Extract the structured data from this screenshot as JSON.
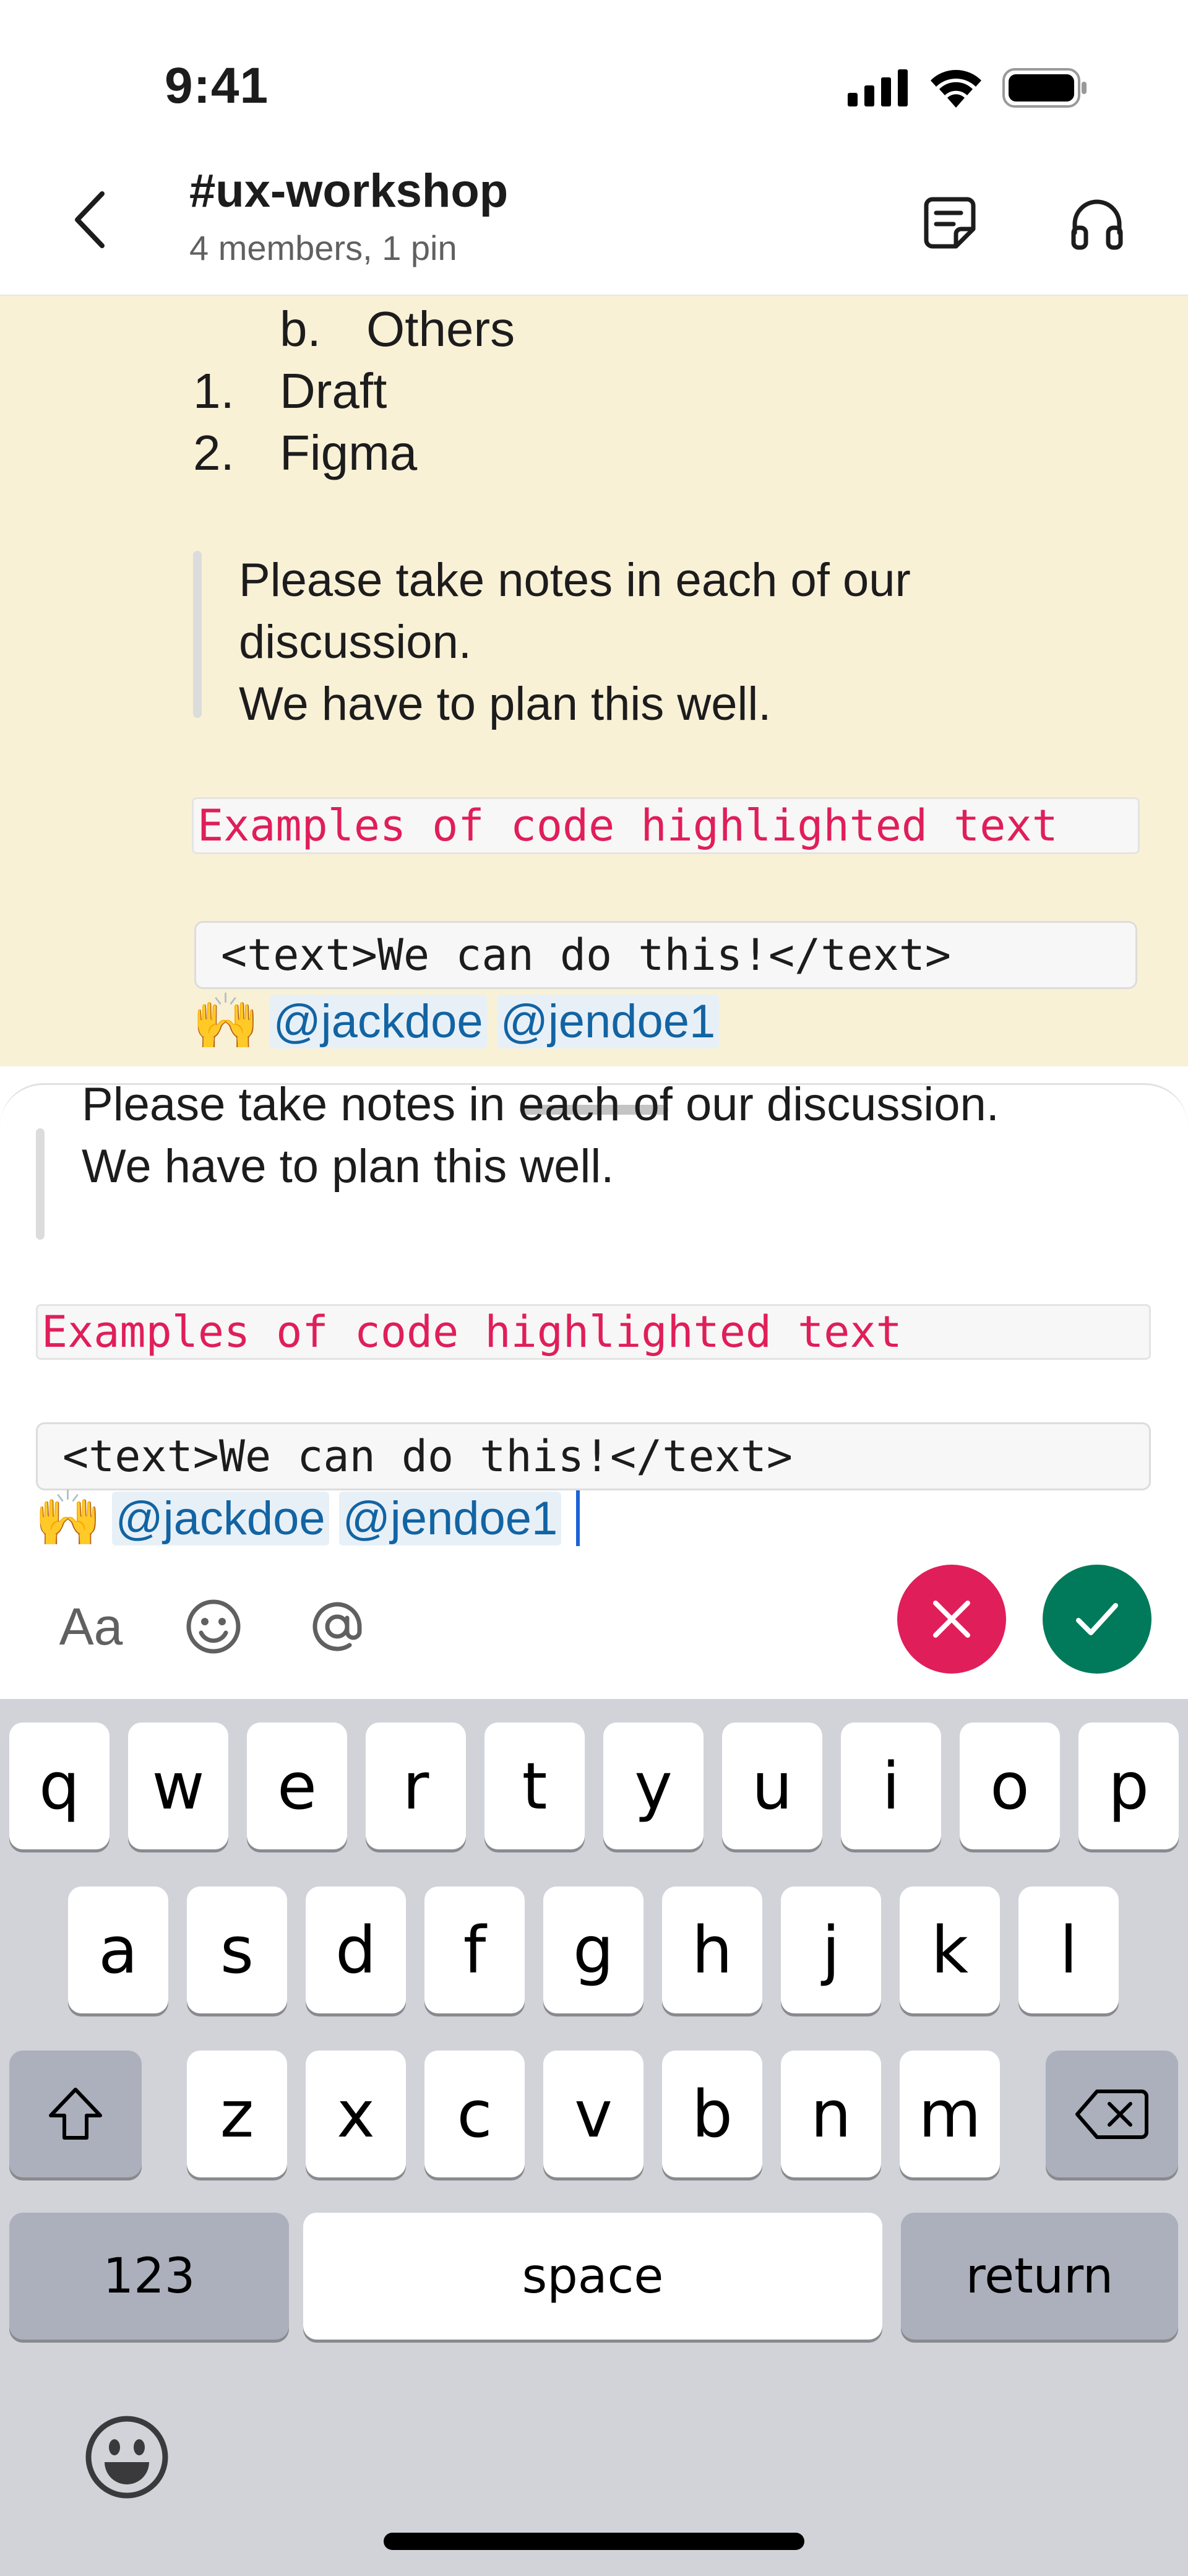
{
  "status_bar": {
    "time": "9:41"
  },
  "header": {
    "channel_name": "#ux-workshop",
    "channel_meta": "4 members, 1 pin"
  },
  "message": {
    "list_sub_item": {
      "marker": "b.",
      "text": "Others"
    },
    "list_items": [
      {
        "marker": "1.",
        "text": "Draft"
      },
      {
        "marker": "2.",
        "text": "Figma"
      }
    ],
    "quote_lines": [
      "Please take notes in each of our",
      "discussion.",
      "We have to plan this well."
    ],
    "inline_code": "Examples of code highlighted text",
    "code_block": "<text>We can do this!</text>",
    "emoji": "🙌",
    "mentions": [
      "@jackdoe",
      "@jendoe1"
    ]
  },
  "compose": {
    "quote_lines": [
      "Please take notes in each of our discussion.",
      "We have to plan this well."
    ],
    "inline_code": "Examples of code highlighted text",
    "code_block": "<text>We can do this!</text>",
    "emoji": "🙌",
    "mentions": [
      "@jackdoe",
      "@jendoe1"
    ],
    "toolbar": {
      "format_label": "Aa"
    },
    "cancel_color": "#e01e5a",
    "confirm_color": "#007a5a"
  },
  "keyboard": {
    "row1": [
      "q",
      "w",
      "e",
      "r",
      "t",
      "y",
      "u",
      "i",
      "o",
      "p"
    ],
    "row2": [
      "a",
      "s",
      "d",
      "f",
      "g",
      "h",
      "j",
      "k",
      "l"
    ],
    "row3": [
      "z",
      "x",
      "c",
      "v",
      "b",
      "n",
      "m"
    ],
    "numbers_label": "123",
    "space_label": "space",
    "return_label": "return"
  }
}
